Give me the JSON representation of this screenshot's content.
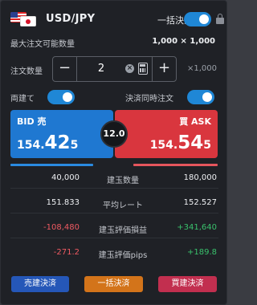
{
  "header": {
    "pair": "USD/JPY",
    "bulk_settle_label": "一括決済",
    "bulk_settle_toggle": "on"
  },
  "order": {
    "max_qty_label": "最大注文可能数量",
    "max_qty_value": "1,000 × 1,000",
    "qty_label": "注文数量",
    "qty_value": "2",
    "minus": "−",
    "plus": "+",
    "clear": "×",
    "multiplier": "×1,000"
  },
  "toggles": {
    "ryodate_label": "両建て",
    "ryodate_state": "on",
    "simul_settle_label": "決済同時注文",
    "simul_settle_state": "on"
  },
  "prices": {
    "bid_label": "BID 売",
    "bid_prefix": "154.",
    "bid_big": "42",
    "bid_suffix": "5",
    "ask_label": "買 ASK",
    "ask_prefix": "154.",
    "ask_big": "54",
    "ask_suffix": "5",
    "spread": "12.0"
  },
  "positions": {
    "rows": [
      {
        "left": "40,000",
        "label": "建玉数量",
        "right": "180,000"
      },
      {
        "left": "151.833",
        "label": "平均レート",
        "right": "152.527"
      },
      {
        "left": "-108,480",
        "label": "建玉評価損益",
        "right": "+341,640"
      },
      {
        "left": "-271.2",
        "label": "建玉評価pips",
        "right": "+189.8"
      }
    ]
  },
  "buttons": {
    "sell_settle": "売建決済",
    "bulk_settle": "一括決済",
    "buy_settle": "買建決済"
  },
  "colors": {
    "bid": "#1f78d1",
    "ask": "#d9363e",
    "toggle": "#1f87d6",
    "negative": "#ef5a62",
    "positive": "#39c16c"
  }
}
